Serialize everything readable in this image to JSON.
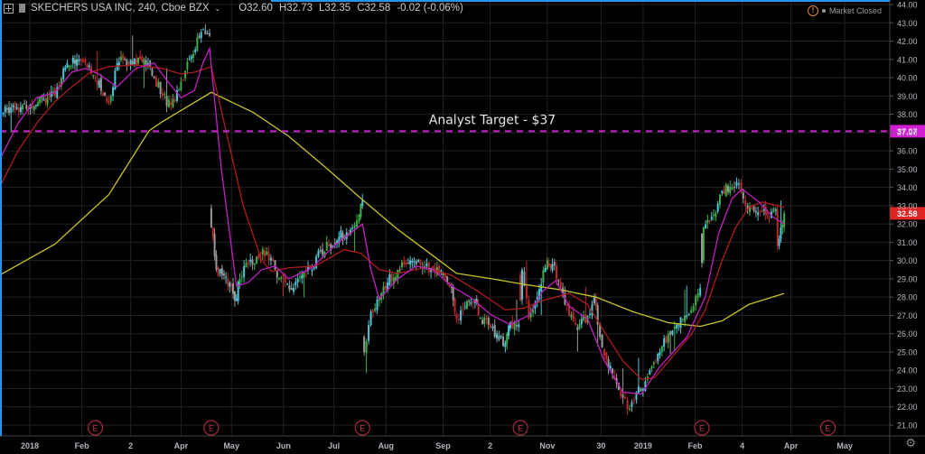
{
  "header": {
    "symbol_line": "SKECHERS USA INC, 240, Cboe BZX",
    "open": "O32.60",
    "high": "H32.73",
    "low": "L32.35",
    "close": "C32.58",
    "change": "-0.02 (-0.06%)",
    "market_status": "Market Closed"
  },
  "colors": {
    "up": "#3fae48",
    "down": "#c0262a",
    "neutral_up": "#4dc8d8",
    "neutral": "#9a9a9a",
    "ma_fast": "#c21fc2",
    "ma_mid": "#b01c1c",
    "ma_slow": "#c8c424",
    "target": "#d21ed2",
    "last": "#e02424",
    "grid": "#222226"
  },
  "chart_data": {
    "type": "candlestick",
    "title": "SKECHERS USA INC, 240, Cboe BZX",
    "x_unit": "days since 2018-01-01",
    "xlim": [
      -18,
      510
    ],
    "ylim": [
      20.6,
      44.3
    ],
    "y_ticks": [
      "21.00",
      "22.00",
      "23.00",
      "24.00",
      "25.00",
      "26.00",
      "27.00",
      "28.00",
      "29.00",
      "30.00",
      "31.00",
      "32.00",
      "33.00",
      "34.00",
      "35.00",
      "36.00",
      "37.00",
      "38.00",
      "39.00",
      "40.00",
      "41.00",
      "42.00",
      "43.00",
      "44.00"
    ],
    "x_ticks": [
      {
        "label": "2018",
        "day": 0
      },
      {
        "label": "Feb",
        "day": 31
      },
      {
        "label": "2",
        "day": 60
      },
      {
        "label": "Apr",
        "day": 90
      },
      {
        "label": "May",
        "day": 120
      },
      {
        "label": "Jun",
        "day": 151
      },
      {
        "label": "Jul",
        "day": 181
      },
      {
        "label": "Aug",
        "day": 212
      },
      {
        "label": "Sep",
        "day": 246
      },
      {
        "label": "2",
        "day": 274
      },
      {
        "label": "Nov",
        "day": 308
      },
      {
        "label": "30",
        "day": 340
      },
      {
        "label": "2019",
        "day": 365
      },
      {
        "label": "Feb",
        "day": 396
      },
      {
        "label": "4",
        "day": 424
      },
      {
        "label": "Apr",
        "day": 453
      },
      {
        "label": "May",
        "day": 485
      }
    ],
    "close": [
      [
        -17,
        38.0
      ],
      [
        -10,
        38.5
      ],
      [
        -2,
        38.3
      ],
      [
        6,
        38.9
      ],
      [
        15,
        39.0
      ],
      [
        20,
        40.5
      ],
      [
        28,
        41.0
      ],
      [
        33,
        40.8
      ],
      [
        39,
        40.0
      ],
      [
        47,
        38.6
      ],
      [
        52,
        40.8
      ],
      [
        60,
        41.0
      ],
      [
        68,
        41.0
      ],
      [
        74,
        40.0
      ],
      [
        79,
        39.0
      ],
      [
        84,
        38.5
      ],
      [
        90,
        39.8
      ],
      [
        95,
        41.0
      ],
      [
        102,
        42.5
      ],
      [
        107,
        42.3
      ],
      [
        108,
        31.8
      ],
      [
        111,
        29.5
      ],
      [
        119,
        28.8
      ],
      [
        122,
        27.8
      ],
      [
        125,
        29.0
      ],
      [
        130,
        29.8
      ],
      [
        135,
        30.2
      ],
      [
        141,
        30.5
      ],
      [
        146,
        29.5
      ],
      [
        152,
        28.8
      ],
      [
        157,
        28.5
      ],
      [
        162,
        29.2
      ],
      [
        168,
        29.5
      ],
      [
        173,
        30.5
      ],
      [
        178,
        30.8
      ],
      [
        184,
        31.3
      ],
      [
        192,
        31.8
      ],
      [
        196,
        32.5
      ],
      [
        198,
        33.3
      ],
      [
        199,
        25.0
      ],
      [
        203,
        27.2
      ],
      [
        208,
        28.0
      ],
      [
        213,
        28.8
      ],
      [
        219,
        29.5
      ],
      [
        224,
        29.8
      ],
      [
        230,
        29.8
      ],
      [
        235,
        29.7
      ],
      [
        240,
        29.5
      ],
      [
        246,
        29.2
      ],
      [
        251,
        28.5
      ],
      [
        254,
        26.8
      ],
      [
        259,
        27.5
      ],
      [
        265,
        27.8
      ],
      [
        267,
        27.0
      ],
      [
        273,
        26.5
      ],
      [
        278,
        26.0
      ],
      [
        283,
        25.5
      ],
      [
        286,
        26.6
      ],
      [
        291,
        26.5
      ],
      [
        293,
        29.5
      ],
      [
        297,
        26.8
      ],
      [
        302,
        28.0
      ],
      [
        308,
        30.0
      ],
      [
        311,
        29.8
      ],
      [
        316,
        28.5
      ],
      [
        321,
        27.0
      ],
      [
        326,
        26.2
      ],
      [
        332,
        27.0
      ],
      [
        336,
        28.0
      ],
      [
        338,
        26.5
      ],
      [
        342,
        24.8
      ],
      [
        348,
        23.5
      ],
      [
        353,
        22.5
      ],
      [
        357,
        21.9
      ],
      [
        361,
        22.8
      ],
      [
        365,
        23.0
      ],
      [
        369,
        24.0
      ],
      [
        375,
        25.0
      ],
      [
        380,
        26.0
      ],
      [
        385,
        26.5
      ],
      [
        391,
        27.0
      ],
      [
        395,
        27.5
      ],
      [
        399,
        28.5
      ],
      [
        401,
        31.8
      ],
      [
        407,
        32.5
      ],
      [
        412,
        33.8
      ],
      [
        418,
        34.0
      ],
      [
        422,
        34.2
      ],
      [
        426,
        33.0
      ],
      [
        431,
        32.7
      ],
      [
        437,
        32.8
      ],
      [
        440,
        32.3
      ],
      [
        444,
        32.8
      ],
      [
        445,
        30.8
      ],
      [
        447,
        31.8
      ],
      [
        449,
        32.58
      ]
    ],
    "ma_fast": [
      [
        -18,
        35.5
      ],
      [
        -7,
        37.5
      ],
      [
        4,
        38.9
      ],
      [
        15,
        39.2
      ],
      [
        25,
        40.3
      ],
      [
        33,
        40.5
      ],
      [
        41,
        40.2
      ],
      [
        52,
        39.5
      ],
      [
        63,
        40.5
      ],
      [
        74,
        40.8
      ],
      [
        82,
        39.8
      ],
      [
        90,
        38.9
      ],
      [
        98,
        39.3
      ],
      [
        103,
        40.8
      ],
      [
        107,
        41.6
      ],
      [
        114,
        35.0
      ],
      [
        123,
        28.6
      ],
      [
        130,
        28.8
      ],
      [
        138,
        29.5
      ],
      [
        146,
        29.7
      ],
      [
        154,
        29.0
      ],
      [
        168,
        29.6
      ],
      [
        181,
        30.8
      ],
      [
        195,
        31.8
      ],
      [
        198,
        32.0
      ],
      [
        203,
        29.5
      ],
      [
        208,
        27.9
      ],
      [
        219,
        29.0
      ],
      [
        230,
        29.7
      ],
      [
        240,
        29.5
      ],
      [
        251,
        28.6
      ],
      [
        262,
        28.0
      ],
      [
        275,
        27.0
      ],
      [
        286,
        26.5
      ],
      [
        297,
        27.0
      ],
      [
        305,
        28.3
      ],
      [
        313,
        28.9
      ],
      [
        321,
        27.5
      ],
      [
        332,
        26.8
      ],
      [
        342,
        24.5
      ],
      [
        353,
        22.8
      ],
      [
        364,
        22.7
      ],
      [
        375,
        24.2
      ],
      [
        391,
        25.8
      ],
      [
        402,
        28.0
      ],
      [
        410,
        31.5
      ],
      [
        418,
        33.4
      ],
      [
        424,
        33.9
      ],
      [
        434,
        33.2
      ],
      [
        442,
        32.4
      ],
      [
        449,
        32.0
      ]
    ],
    "ma_mid": [
      [
        -18,
        34.0
      ],
      [
        -7,
        36.0
      ],
      [
        4,
        37.5
      ],
      [
        15,
        38.7
      ],
      [
        25,
        39.5
      ],
      [
        36,
        40.3
      ],
      [
        47,
        40.6
      ],
      [
        63,
        40.7
      ],
      [
        79,
        40.5
      ],
      [
        90,
        40.2
      ],
      [
        98,
        40.3
      ],
      [
        108,
        40.6
      ],
      [
        117,
        37.0
      ],
      [
        127,
        33.0
      ],
      [
        138,
        30.0
      ],
      [
        144,
        29.4
      ],
      [
        154,
        29.6
      ],
      [
        170,
        29.7
      ],
      [
        187,
        30.6
      ],
      [
        197,
        30.4
      ],
      [
        208,
        29.5
      ],
      [
        219,
        29.3
      ],
      [
        235,
        29.6
      ],
      [
        251,
        29.2
      ],
      [
        267,
        28.3
      ],
      [
        283,
        27.3
      ],
      [
        294,
        27.4
      ],
      [
        305,
        27.8
      ],
      [
        321,
        28.2
      ],
      [
        332,
        27.6
      ],
      [
        342,
        26.1
      ],
      [
        353,
        24.5
      ],
      [
        364,
        23.5
      ],
      [
        372,
        23.6
      ],
      [
        383,
        24.8
      ],
      [
        394,
        26.0
      ],
      [
        402,
        27.3
      ],
      [
        412,
        30.0
      ],
      [
        420,
        31.8
      ],
      [
        428,
        32.9
      ],
      [
        436,
        33.2
      ],
      [
        445,
        33.0
      ],
      [
        449,
        32.9
      ]
    ],
    "ma_slow": [
      [
        -18,
        29.2
      ],
      [
        15,
        30.9
      ],
      [
        47,
        33.6
      ],
      [
        71,
        37.1
      ],
      [
        79,
        37.6
      ],
      [
        108,
        39.2
      ],
      [
        133,
        38.1
      ],
      [
        154,
        36.8
      ],
      [
        176,
        35.1
      ],
      [
        197,
        33.4
      ],
      [
        219,
        31.7
      ],
      [
        238,
        30.4
      ],
      [
        254,
        29.3
      ],
      [
        275,
        29.0
      ],
      [
        294,
        28.7
      ],
      [
        316,
        28.4
      ],
      [
        337,
        28.0
      ],
      [
        359,
        27.2
      ],
      [
        380,
        26.6
      ],
      [
        399,
        26.4
      ],
      [
        412,
        26.7
      ],
      [
        428,
        27.6
      ],
      [
        449,
        28.2
      ]
    ],
    "target_line": {
      "value": 37.07,
      "label": "Analyst Target - $37",
      "price_label": "37.07"
    },
    "last_price": {
      "value": 32.58,
      "label": "32.58"
    },
    "earnings_days": [
      39,
      108,
      198,
      292,
      400,
      475
    ],
    "earnings_marker": "E"
  }
}
